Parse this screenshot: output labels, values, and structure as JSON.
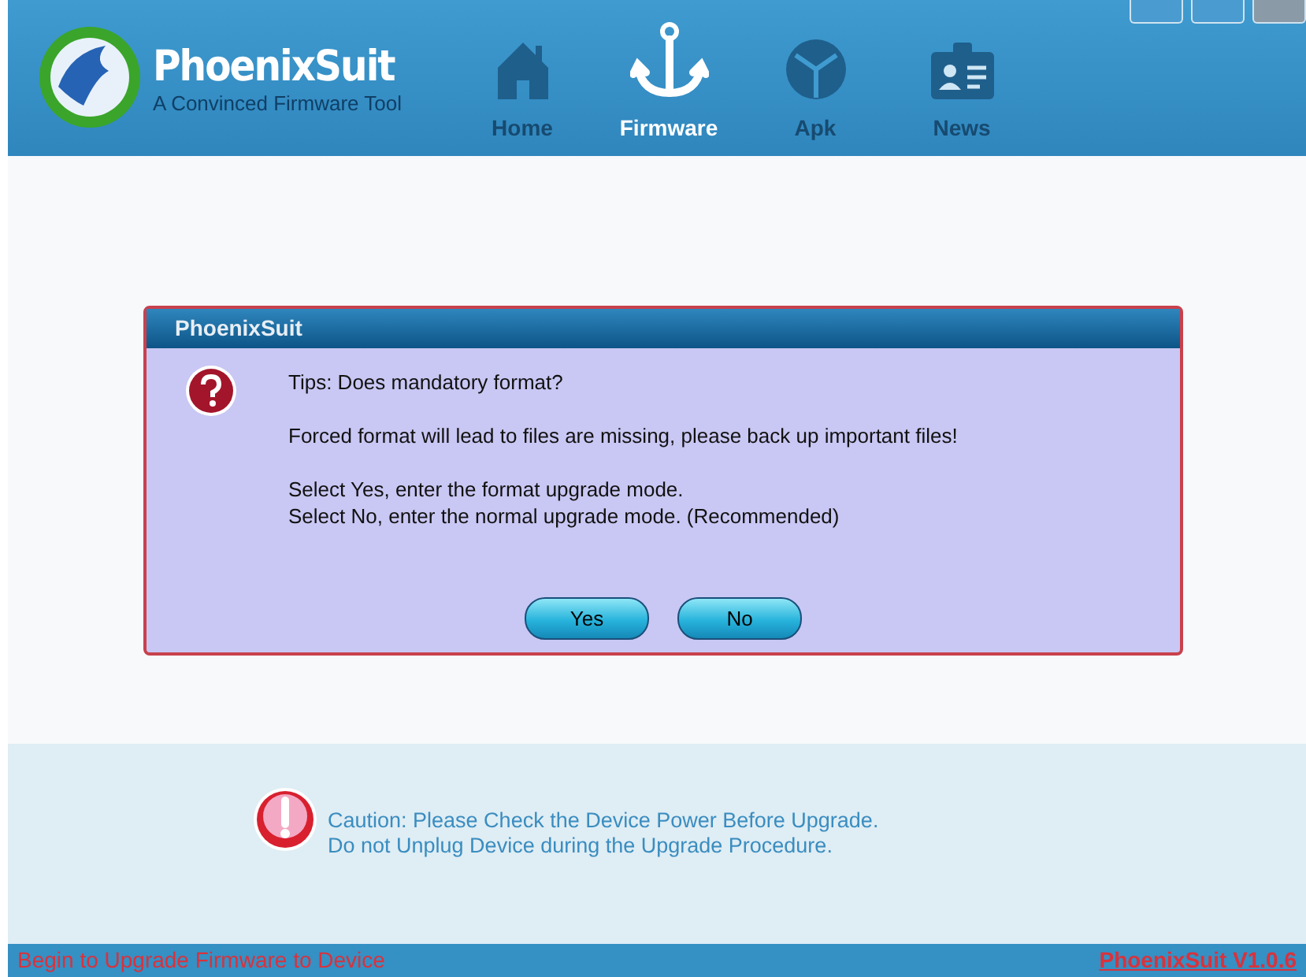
{
  "app": {
    "name": "PhoenixSuit",
    "tagline": "A Convinced Firmware Tool"
  },
  "nav": [
    {
      "label": "Home",
      "kind": "home",
      "selected": false
    },
    {
      "label": "Firmware",
      "kind": "anchor",
      "selected": true
    },
    {
      "label": "Apk",
      "kind": "apk",
      "selected": false
    },
    {
      "label": "News",
      "kind": "news",
      "selected": false
    }
  ],
  "dialog": {
    "title": "PhoenixSuit",
    "lines": [
      "Tips: Does mandatory format?",
      "Forced format will lead to files are missing, please back up important files!",
      "Select Yes, enter the format upgrade mode.\nSelect No, enter the normal upgrade mode. (Recommended)"
    ],
    "buttons": [
      "Yes",
      "No"
    ]
  },
  "caution": [
    "Caution: Please Check the Device Power Before Upgrade.",
    "Do not Unplug Device during the Upgrade Procedure."
  ],
  "status_bar": {
    "message": "Begin to Upgrade Firmware to Device",
    "version": "PhoenixSuit V1.0.6"
  }
}
